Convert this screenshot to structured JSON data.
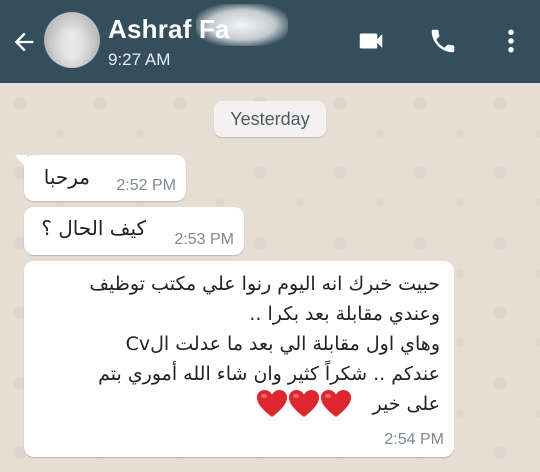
{
  "header": {
    "contact_name": "Ashraf Fa",
    "last_seen": "9:27 AM",
    "icons": [
      "arrow-back-icon",
      "avatar",
      "video-call-icon",
      "voice-call-icon",
      "more-vert-icon"
    ],
    "background_color": "#344e5c"
  },
  "chat": {
    "date_label": "Yesterday",
    "background_color": "#e6ddd3",
    "messages": [
      {
        "text": "مرحبا",
        "time": "2:52 PM"
      },
      {
        "text": "كيف الحال ؟",
        "time": "2:53 PM"
      },
      {
        "text": "حبيت خبرك انه اليوم رنوا علي مكتب توظيف\nوعندي مقابلة بعد بكرا ..\nوهاي اول مقابلة الي بعد ما عدلت الCv\nعندكم .. شكراً كثير وان شاء الله أموري بتم\nعلى خير",
        "emoji": [
          "heart-icon",
          "heart-icon",
          "heart-icon"
        ],
        "time": "2:54 PM"
      }
    ]
  }
}
